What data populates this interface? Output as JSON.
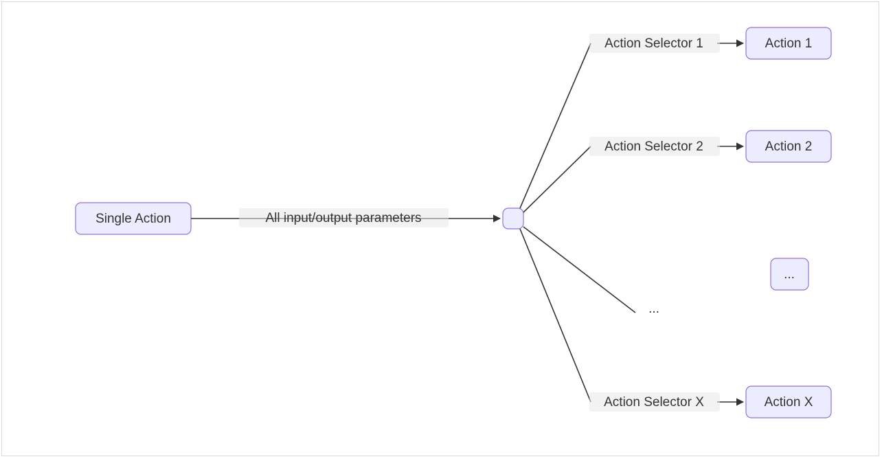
{
  "diagram": {
    "nodes": {
      "single_action": {
        "label": "Single Action"
      },
      "hub": {
        "label": ""
      },
      "action_1": {
        "label": "Action 1"
      },
      "action_2": {
        "label": "Action 2"
      },
      "ellipsis_box": {
        "label": "..."
      },
      "action_x": {
        "label": "Action X"
      }
    },
    "edges": {
      "params": {
        "label": "All input/output parameters"
      },
      "sel1": {
        "label": "Action Selector 1"
      },
      "sel2": {
        "label": "Action Selector 2"
      },
      "selx": {
        "label": "Action Selector X"
      }
    },
    "free_text": {
      "branch_ellipsis": "..."
    },
    "colors": {
      "node_fill": "#ECECFF",
      "node_stroke": "#9370DB",
      "line": "#333333",
      "text": "#333333",
      "frame": "#d9d9d9"
    }
  }
}
